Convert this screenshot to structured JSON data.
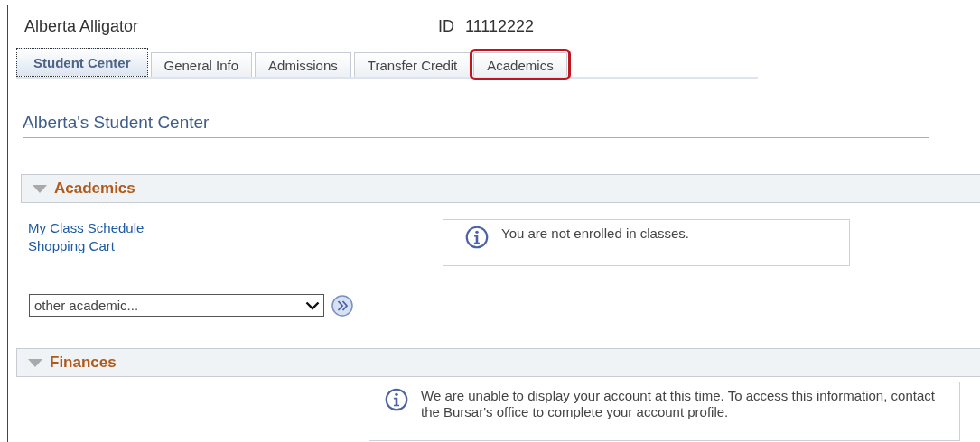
{
  "header": {
    "student_name": "Alberta Alligator",
    "id_label": "ID",
    "id_value": "11112222"
  },
  "tabs": [
    {
      "label": "Student Center",
      "selected": true,
      "highlighted": false
    },
    {
      "label": "General Info",
      "selected": false,
      "highlighted": false
    },
    {
      "label": "Admissions",
      "selected": false,
      "highlighted": false
    },
    {
      "label": "Transfer Credit",
      "selected": false,
      "highlighted": false
    },
    {
      "label": "Academics",
      "selected": false,
      "highlighted": true
    }
  ],
  "page_title": "Alberta's Student Center",
  "sections": [
    {
      "title": "Academics",
      "expanded": true,
      "links": [
        "My Class Schedule",
        "Shopping Cart"
      ],
      "dropdown": {
        "value": "other academic..."
      },
      "message": "You are not enrolled in classes."
    },
    {
      "title": "Finances",
      "expanded": true,
      "message": "We are unable to display your account at this time.  To access this information, contact the Bursar's office to complete your account profile."
    }
  ]
}
